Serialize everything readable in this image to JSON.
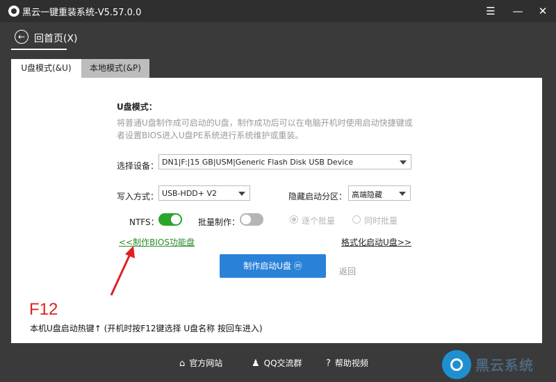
{
  "titlebar": {
    "title": "黑云一键重装系统-V5.57.0.0",
    "menu_glyph": "☰",
    "min_glyph": "—",
    "close_glyph": "✕"
  },
  "nav": {
    "back_label": "回首页(X)",
    "back_glyph": "←"
  },
  "tabs": [
    {
      "label": "U盘模式(&U)",
      "active": true
    },
    {
      "label": "本地模式(&P)",
      "active": false
    }
  ],
  "usb_mode": {
    "heading": "U盘模式：",
    "description": "将普通U盘制作成可启动的U盘，制作成功后可以在电脑开机时使用启动快捷键或者设置BIOS进入U盘PE系统进行系统维护或重装。",
    "device_label": "选择设备：",
    "device_value": "DN1|F:|15 GB|USM|Generic Flash Disk USB Device",
    "write_mode_label": "写入方式：",
    "write_mode_value": "USB-HDD+ V2",
    "hidden_partition_label": "隐藏启动分区：",
    "hidden_partition_value": "高端隐藏",
    "ntfs_label": "NTFS：",
    "ntfs_on": true,
    "batch_label": "批量制作：",
    "batch_on": false,
    "radio_one_by_one": "逐个批量",
    "radio_simultaneous": "同时批量",
    "bios_link": "<<制作BIOS功能盘",
    "format_link": "格式化启动U盘>>",
    "make_button": "制作启动U盘 ⓜ",
    "return_label": "返回"
  },
  "hint": {
    "key": "F12",
    "text": "本机U盘启动热键↑ (开机时按F12键选择 U盘名称 按回车进入)"
  },
  "footer": {
    "official_site": "官方网站",
    "qq_group": "QQ交流群",
    "help_video": "帮助视频",
    "brand": "黑云系统"
  },
  "colors": {
    "primary_button": "#2a82d8",
    "toggle_on": "#2aa52a",
    "link_green": "#2a8a2a",
    "hotkey_red": "#e02020"
  }
}
